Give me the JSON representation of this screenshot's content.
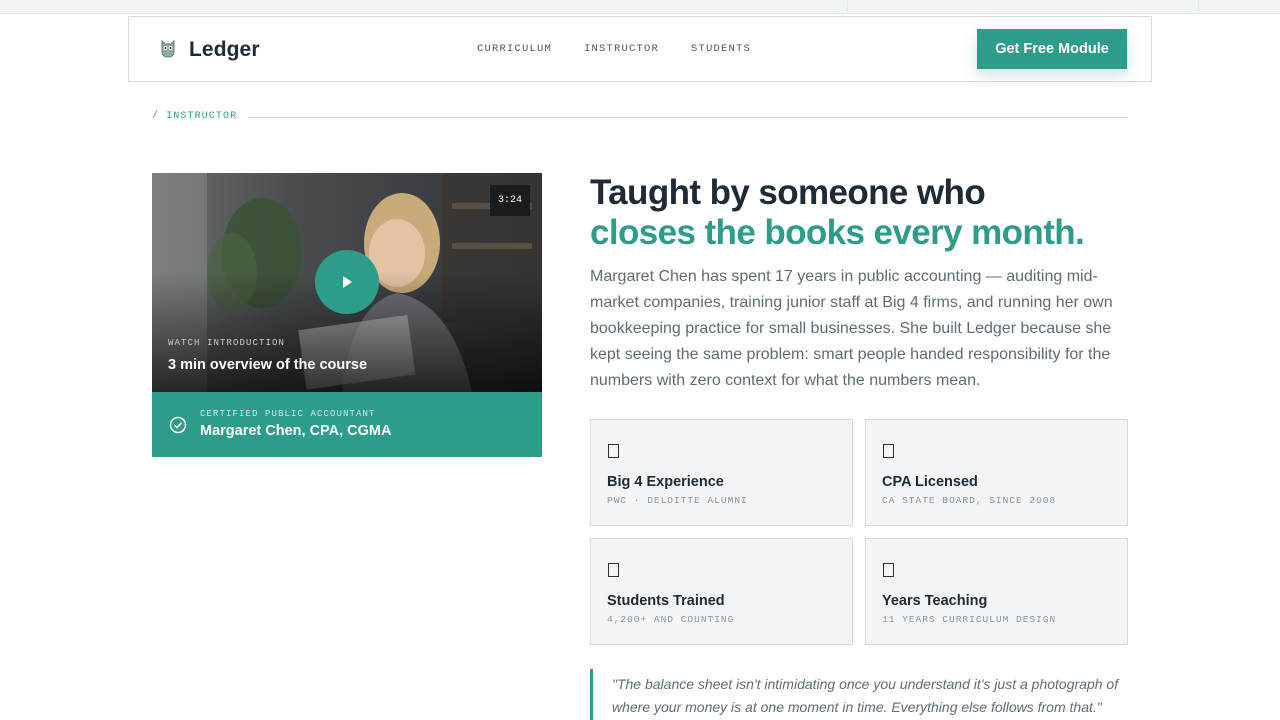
{
  "brand": {
    "name": "Ledger",
    "icon": "owl-icon"
  },
  "nav": {
    "links": [
      "CURRICULUM",
      "INSTRUCTOR",
      "STUDENTS"
    ],
    "cta_label": "Get Free Module"
  },
  "section": {
    "eyebrow": "/ INSTRUCTOR"
  },
  "video": {
    "duration": "3:24",
    "label": "WATCH INTRODUCTION",
    "title": "3 min overview of the course",
    "play_icon": "play-icon"
  },
  "credential": {
    "label": "CERTIFIED PUBLIC ACCOUNTANT",
    "name": "Margaret Chen, CPA, CGMA",
    "icon": "check-circle-icon"
  },
  "headline": {
    "line1": "Taught by someone who",
    "line2": "closes the books every month."
  },
  "bio": "Margaret Chen has spent 17 years in public accounting — auditing mid-market companies, training junior staff at Big 4 firms, and running her own bookkeeping practice for small businesses. She built Ledger because she kept seeing the same problem: smart people handed responsibility for the numbers with zero context for what the numbers mean.",
  "cards": [
    {
      "title": "Big 4 Experience",
      "subtitle": "PWC · DELOITTE ALUMNI"
    },
    {
      "title": "CPA Licensed",
      "subtitle": "CA STATE BOARD, SINCE 2008"
    },
    {
      "title": "Students Trained",
      "subtitle": "4,200+ AND COUNTING"
    },
    {
      "title": "Years Teaching",
      "subtitle": "11 YEARS CURRICULUM DESIGN"
    }
  ],
  "quote": "\"The balance sheet isn't intimidating once you understand it's just a photograph of where your money is at one moment in time. Everything else follows from that.\"",
  "colors": {
    "accent": "#2e9c8a",
    "text": "#1e2a36",
    "muted": "#5f6b75"
  }
}
